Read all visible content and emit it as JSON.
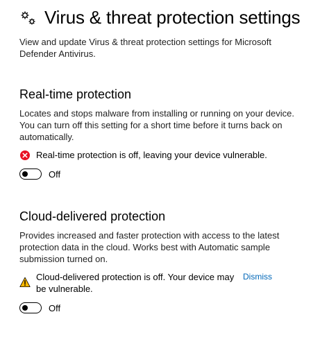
{
  "header": {
    "title": "Virus & threat protection settings",
    "subtitle": "View and update Virus & threat protection settings for Microsoft Defender Antivirus."
  },
  "realtime": {
    "title": "Real-time protection",
    "description": "Locates and stops malware from installing or running on your device. You can turn off this setting for a short time before it turns back on automatically.",
    "alert_text": "Real-time protection is off, leaving your device vulnerable.",
    "alert_icon": "error-x-icon",
    "alert_color": "#e81123",
    "toggle_label": "Off"
  },
  "cloud": {
    "title": "Cloud-delivered protection",
    "description": "Provides increased and faster protection with access to the latest protection data in the cloud. Works best with Automatic sample submission turned on.",
    "alert_text": "Cloud-delivered protection is off. Your device may be vulnerable.",
    "alert_icon": "warning-triangle-icon",
    "alert_color": "#ffb900",
    "dismiss_label": "Dismiss",
    "toggle_label": "Off"
  },
  "colors": {
    "link": "#0067b8"
  }
}
